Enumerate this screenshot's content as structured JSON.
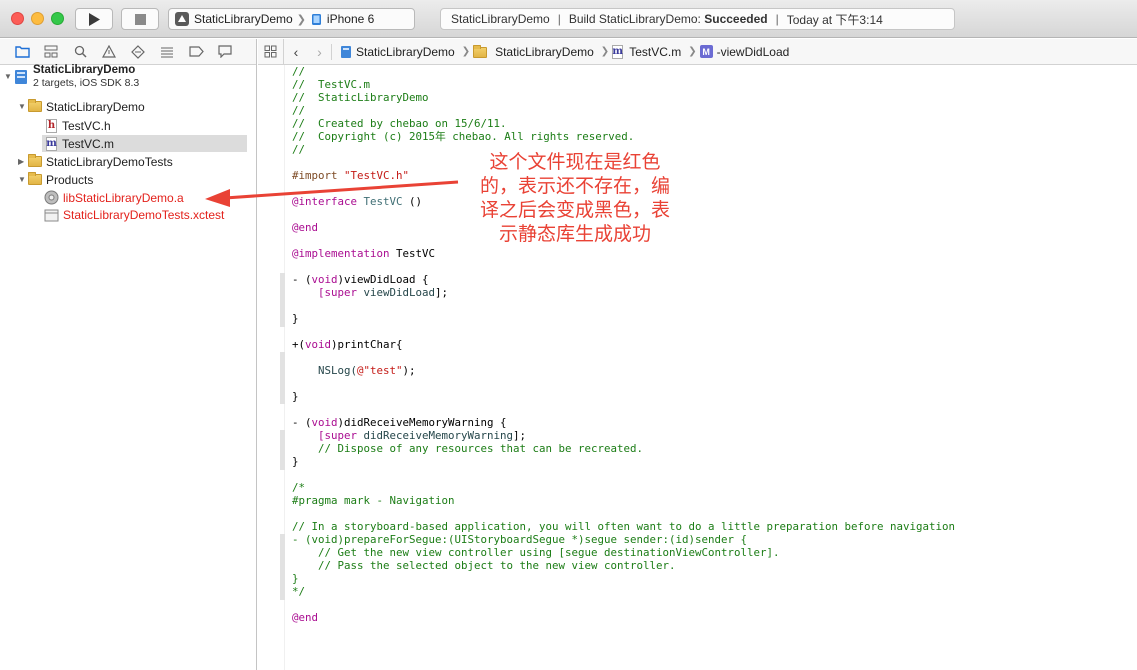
{
  "toolbar": {
    "scheme_name": "StaticLibraryDemo",
    "device": "iPhone 6",
    "activity_project": "StaticLibraryDemo",
    "activity_build_prefix": "Build StaticLibraryDemo:",
    "activity_build_status": "Succeeded",
    "activity_time": "Today at 下午3:14"
  },
  "navigator": {
    "project_name": "StaticLibraryDemo",
    "project_subtitle": "2 targets, iOS SDK 8.3",
    "items": [
      {
        "label": "StaticLibraryDemo"
      },
      {
        "label": "TestVC.h"
      },
      {
        "label": "TestVC.m"
      },
      {
        "label": "StaticLibraryDemoTests"
      },
      {
        "label": "Products"
      },
      {
        "label": "libStaticLibraryDemo.a"
      },
      {
        "label": "StaticLibraryDemoTests.xctest"
      }
    ]
  },
  "jumpbar": {
    "project": "StaticLibraryDemo",
    "group": "StaticLibraryDemo",
    "file": "TestVC.m",
    "method": "-viewDidLoad"
  },
  "code": {
    "l1": "//",
    "l2": "//  TestVC.m",
    "l3": "//  StaticLibraryDemo",
    "l4": "//",
    "l5": "//  Created by chebao on 15/6/11.",
    "l6": "//  Copyright (c) 2015年 chebao. All rights reserved.",
    "l7": "//",
    "import_kw": "#import ",
    "import_str": "\"TestVC.h\"",
    "interface_kw": "@interface ",
    "interface_cls": "TestVC",
    "interface_rest": " ()",
    "end1": "@end",
    "impl_kw": "@implementation ",
    "impl_name": "TestVC",
    "vdl_a": "- (",
    "vdl_void": "void",
    "vdl_b": ")viewDidLoad {",
    "vdl_super": "    [super ",
    "vdl_call": "viewDidLoad",
    "vdl_end": "];",
    "brace": "}",
    "pc_a": "+(",
    "pc_void": "void",
    "pc_b": ")printChar{",
    "ns_a": "    NSLog(",
    "ns_str": "@\"test\"",
    "ns_b": ");",
    "drm_a": "- (",
    "drm_void": "void",
    "drm_b": ")didReceiveMemoryWarning {",
    "drm_super": "    [super ",
    "drm_call": "didReceiveMemoryWarning",
    "drm_end": "];",
    "drm_cmt": "    // Dispose of any resources that can be recreated.",
    "blk_open": "/*",
    "pragma": "#pragma mark - Navigation",
    "nav_cmt": "// In a storyboard-based application, you will often want to do a little preparation before navigation",
    "seg": "- (void)prepareForSegue:(UIStoryboardSegue *)segue sender:(id)sender {",
    "seg_c1": "    // Get the new view controller using [segue destinationViewController].",
    "seg_c2": "    // Pass the selected object to the new view controller.",
    "blk_close": "*/",
    "end2": "@end"
  },
  "annotation": {
    "line1": "这个文件现在是红色",
    "line2": "的，表示还不存在，编",
    "line3": "译之后会变成黑色，表",
    "line4": "示静态库生成成功"
  },
  "colors": {
    "missing_file": "#e3221c",
    "annotation": "#e94235",
    "comment": "#1c7d16",
    "keyword": "#aa0d91"
  }
}
